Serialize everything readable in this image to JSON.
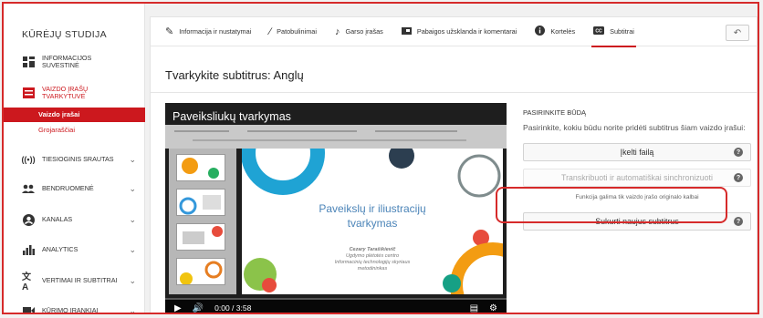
{
  "sidebar": {
    "studio_title": "KŪRĖJŲ STUDIJA",
    "items": [
      {
        "label": "INFORMACIJOS SUVESTINĖ",
        "icon": "dashboard-icon"
      },
      {
        "label": "VAIZDO ĮRAŠŲ TVARKYTUVĖ",
        "icon": "video-manager-icon"
      },
      {
        "label": "TIESIOGINIS SRAUTAS",
        "icon": "live-icon"
      },
      {
        "label": "BENDRUOMENĖ",
        "icon": "community-icon"
      },
      {
        "label": "KANALAS",
        "icon": "channel-icon"
      },
      {
        "label": "ANALYTICS",
        "icon": "analytics-icon"
      },
      {
        "label": "VERTIMAI IR SUBTITRAI",
        "icon": "translate-icon"
      },
      {
        "label": "KŪRIMO ĮRANKIAI",
        "icon": "create-icon"
      }
    ],
    "sub_active": "Vaizdo įrašai",
    "sub_item": "Grojaraščiai"
  },
  "tabs": [
    {
      "label": "Informacija ir nustatymai",
      "icon": "pencil-icon"
    },
    {
      "label": "Patobulinimai",
      "icon": "magic-wand-icon"
    },
    {
      "label": "Garso įrašas",
      "icon": "music-note-icon"
    },
    {
      "label": "Pabaigos užsklanda ir komentarai",
      "icon": "end-screen-icon"
    },
    {
      "label": "Kortelės",
      "icon": "info-icon"
    },
    {
      "label": "Subtitrai",
      "icon": "cc-icon"
    }
  ],
  "page_title": "Tvarkykite subtitrus: Anglų",
  "video": {
    "title": "Paveiksliukų tvarkymas",
    "slide_title_line1": "Paveikslų ir iliustracijų",
    "slide_title_line2": "tvarkymas",
    "slide_author": "Cezary Tarašikievič",
    "slide_line2": "Ugdymo plėtotės centro",
    "slide_line3": "Informacinių technologijų skyriaus",
    "slide_line4": "metodininkas",
    "time": "0:00 / 3:58"
  },
  "panel": {
    "heading": "PASIRINKITE BŪDĄ",
    "description": "Pasirinkite, kokiu būdu norite pridėti subtitrus šiam vaizdo įrašui:",
    "upload_label": "Įkelti failą",
    "transcribe_label": "Transkribuoti ir automatiškai sinchronizuoti",
    "note": "Funkcija galima tik vaizdo įrašo originalo kalbai",
    "create_label": "Sukurti naujus subtitrus"
  },
  "colors": {
    "accent": "#cc181e",
    "highlight": "#d62a2a"
  }
}
